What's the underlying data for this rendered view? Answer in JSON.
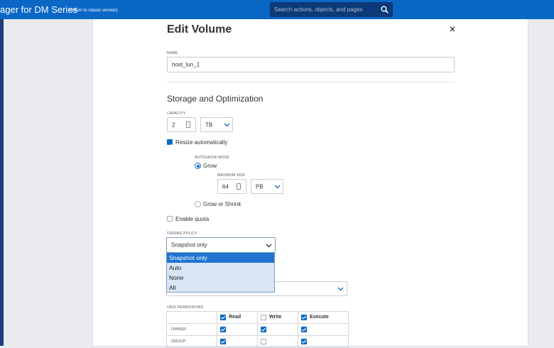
{
  "header": {
    "app_title": "ager for DM Series",
    "classic_link": "(Return to classic version)",
    "search_placeholder": "Search actions, objects, and pages"
  },
  "dialog": {
    "title": "Edit Volume",
    "close_icon": "close-icon",
    "name_label": "NAME",
    "name_value": "host_lun_1",
    "section_title": "Storage and Optimization",
    "capacity_label": "CAPACITY",
    "capacity_value": "2",
    "capacity_unit": "TB",
    "resize_label": "Resize automatically",
    "resize_checked": true,
    "autogrow_label": "AUTOGROW MODE",
    "grow_label": "Grow",
    "max_size_label": "MAXIMUM SIZE",
    "max_size_value": "64",
    "max_size_unit": "PB",
    "grow_shrink_label": "Grow or Shrink",
    "quota_label": "Enable quota",
    "tiering_label": "TIERING POLICY",
    "tiering_value": "Snapshot only",
    "tiering_options": [
      "Snapshot only",
      "Auto",
      "None",
      "All"
    ],
    "unix_label": "UNIX PERMISSIONS",
    "perm_headers": [
      "Read",
      "Write",
      "Execute"
    ],
    "perm_rows": [
      {
        "name": "OWNER",
        "read": true,
        "write": true,
        "execute": true
      },
      {
        "name": "GROUP",
        "read": true,
        "write": false,
        "execute": true
      }
    ]
  },
  "colors": {
    "accent": "#0a67c6",
    "topbar": "#0a67c6",
    "search_bg": "#0c3a78"
  }
}
